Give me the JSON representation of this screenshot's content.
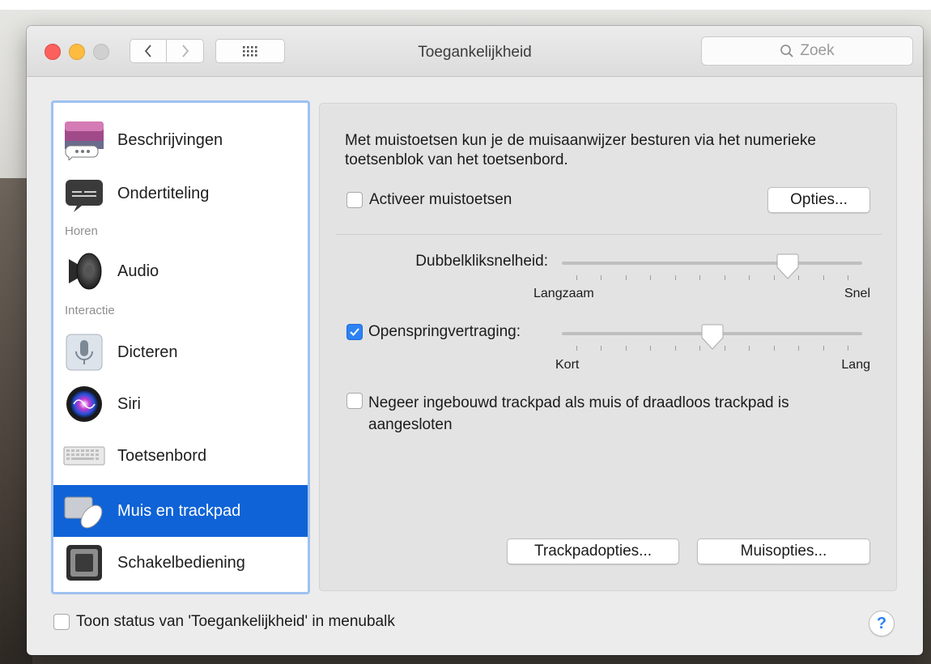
{
  "window": {
    "title": "Toegankelijkheid"
  },
  "search": {
    "placeholder": "Zoek"
  },
  "sidebar": {
    "items": [
      {
        "label": "Beschrijvingen",
        "icon": "descriptions-icon"
      },
      {
        "label": "Ondertiteling",
        "icon": "captions-icon"
      },
      {
        "label": "Audio",
        "icon": "speaker-icon"
      },
      {
        "label": "Dicteren",
        "icon": "microphone-icon"
      },
      {
        "label": "Siri",
        "icon": "siri-icon"
      },
      {
        "label": "Toetsenbord",
        "icon": "keyboard-icon"
      },
      {
        "label": "Muis en trackpad",
        "icon": "mouse-trackpad-icon",
        "selected": true
      },
      {
        "label": "Schakelbediening",
        "icon": "switch-control-icon"
      }
    ],
    "sections": {
      "hearing": "Horen",
      "interaction": "Interactie"
    }
  },
  "panel": {
    "intro": "Met muistoetsen kun je de muisaanwijzer besturen via het numerieke toetsenblok van het toetsenbord.",
    "mouse_keys": {
      "label": "Activeer muistoetsen",
      "checked": false
    },
    "options_button": "Opties...",
    "double_click": {
      "label": "Dubbelkliksnelheid:",
      "min_label": "Langzaam",
      "max_label": "Snel",
      "value": 0.78
    },
    "spring_loading": {
      "label": "Openspringvertraging:",
      "checked": true,
      "min_label": "Kort",
      "max_label": "Lang",
      "value": 0.5
    },
    "ignore_trackpad": {
      "label": "Negeer ingebouwd trackpad als muis of draadloos trackpad is aangesloten",
      "checked": false
    },
    "trackpad_options_button": "Trackpadopties...",
    "mouse_options_button": "Muisopties..."
  },
  "footer": {
    "show_status": {
      "label": "Toon status van 'Toegankelijkheid' in menubalk",
      "checked": false
    },
    "help": "?"
  },
  "colors": {
    "accent": "#0f63d7",
    "checkbox_checked": "#2d82f5"
  }
}
